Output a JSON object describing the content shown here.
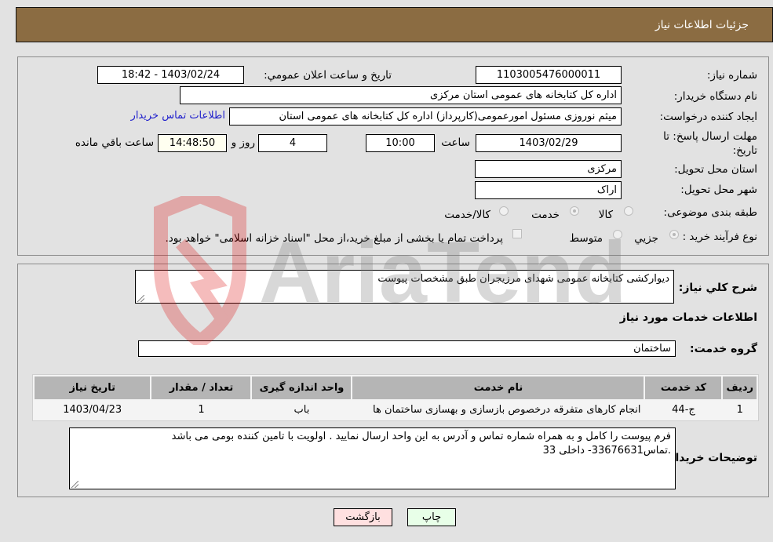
{
  "header": {
    "title": "جزئیات اطلاعات نیاز"
  },
  "details": {
    "need_number": {
      "label": "شماره نیاز:",
      "value": "1103005476000011"
    },
    "announce_datetime": {
      "label": "تاريخ و ساعت اعلان عمومي:",
      "value": "1403/02/24 - 18:42"
    },
    "buyer_org": {
      "label": "نام دستگاه خریدار:",
      "value": "اداره کل کتابخانه های عمومی استان مرکزی"
    },
    "requester": {
      "label": "ایجاد کننده درخواست:",
      "value": "میثم نوروزی مسئول امورعمومی(کارپرداز) اداره کل کتابخانه های عمومی استان",
      "contact_link": "اطلاعات تماس خریدار"
    },
    "deadline": {
      "label": "مهلت ارسال پاسخ: تا تاریخ:",
      "date": "1403/02/29",
      "time_label": "ساعت",
      "time": "10:00",
      "days": "4",
      "days_label": "روز و",
      "remaining": "14:48:50",
      "remaining_label": "ساعت باقي مانده"
    },
    "delivery_province": {
      "label": "استان محل تحویل:",
      "value": "مرکزی"
    },
    "delivery_city": {
      "label": "شهر محل تحویل:",
      "value": "اراک"
    },
    "category": {
      "label": "طبقه بندی موضوعی:",
      "options": [
        "کالا",
        "خدمت",
        "کالا/خدمت"
      ],
      "selected": "خدمت"
    },
    "purchase_type": {
      "label": "نوع فرآیند خرید :",
      "options": [
        "جزيي",
        "متوسط"
      ],
      "selected": "جزيي",
      "treasury_checkbox_label": "پرداخت تمام یا بخشی از مبلغ خرید،از محل \"اسناد خزانه اسلامی\" خواهد بود."
    }
  },
  "summary": {
    "label": "شرح کلي نياز:",
    "value": "دیوارکشی کتابخانه عمومی شهدای مرزیجران طبق مشخصات پیوست"
  },
  "services_section": {
    "title": "اطلاعات خدمات مورد نیاز"
  },
  "service_group": {
    "label": "گروه خدمت:",
    "value": "ساختمان"
  },
  "table": {
    "headers": [
      "ردیف",
      "کد خدمت",
      "نام خدمت",
      "واحد اندازه گیری",
      "تعداد / مقدار",
      "تاریخ نیاز"
    ],
    "rows": [
      [
        "1",
        "ج-44",
        "انجام کارهای متفرقه درخصوص بازسازی و بهسازی ساختمان ها",
        "باب",
        "1",
        "1403/04/23"
      ]
    ]
  },
  "buyer_notes": {
    "label": "توضیحات خریدار:",
    "line1": "فرم پیوست را کامل و به همراه شماره تماس و آدرس به این واحد ارسال نمایید . اولویت با تامین کننده بومی می باشد",
    "line2": ".تماس33676631- داخلی 33"
  },
  "buttons": {
    "print": "چاپ",
    "back": "بازگشت"
  },
  "watermark": {
    "text": "AriaTender.neT"
  }
}
